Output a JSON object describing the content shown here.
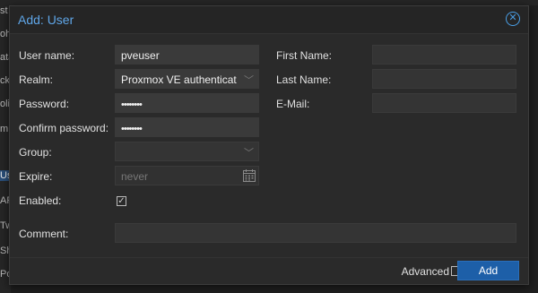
{
  "background": {
    "sidebar_fragments": [
      "st",
      "oh",
      "ata",
      "ck",
      "oli",
      "m",
      "Us",
      "AF",
      "Tw",
      "Sh",
      "Po"
    ],
    "highlight_color": "#2a4f7a"
  },
  "dialog": {
    "title": "Add: User",
    "close_icon": "close-circle-icon",
    "accent_color": "#4a9fe6"
  },
  "form": {
    "username": {
      "label": "User name:",
      "value": "pveuser"
    },
    "realm": {
      "label": "Realm:",
      "value": "Proxmox VE authenticat"
    },
    "password": {
      "label": "Password:",
      "value": "••••••••"
    },
    "confirm_password": {
      "label": "Confirm password:",
      "value": "••••••••"
    },
    "group": {
      "label": "Group:",
      "value": ""
    },
    "expire": {
      "label": "Expire:",
      "placeholder": "never",
      "icon": "calendar-icon"
    },
    "enabled": {
      "label": "Enabled:",
      "checked": true
    },
    "first_name": {
      "label": "First Name:",
      "value": ""
    },
    "last_name": {
      "label": "Last Name:",
      "value": ""
    },
    "email": {
      "label": "E-Mail:",
      "value": ""
    },
    "comment": {
      "label": "Comment:",
      "value": ""
    }
  },
  "footer": {
    "advanced_label": "Advanced",
    "advanced_checked": false,
    "add_label": "Add",
    "add_color": "#1d5fa8"
  }
}
